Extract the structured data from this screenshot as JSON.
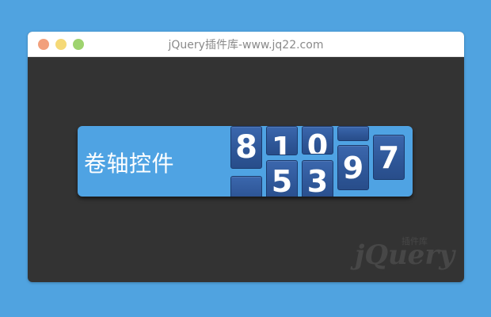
{
  "window": {
    "title": "jQuery插件库-www.jq22.com",
    "colors": {
      "close": "#f2a07c",
      "minimize": "#f5d977",
      "maximize": "#9ed36f"
    }
  },
  "widget": {
    "label": "卷轴控件",
    "digits": [
      "8",
      "1",
      "0",
      "5",
      "3",
      "9",
      "7"
    ],
    "accent": "#4fa3e3",
    "tile_color": "#2e5697"
  },
  "watermark": {
    "text": "jQuery",
    "subtext": "插件库"
  }
}
